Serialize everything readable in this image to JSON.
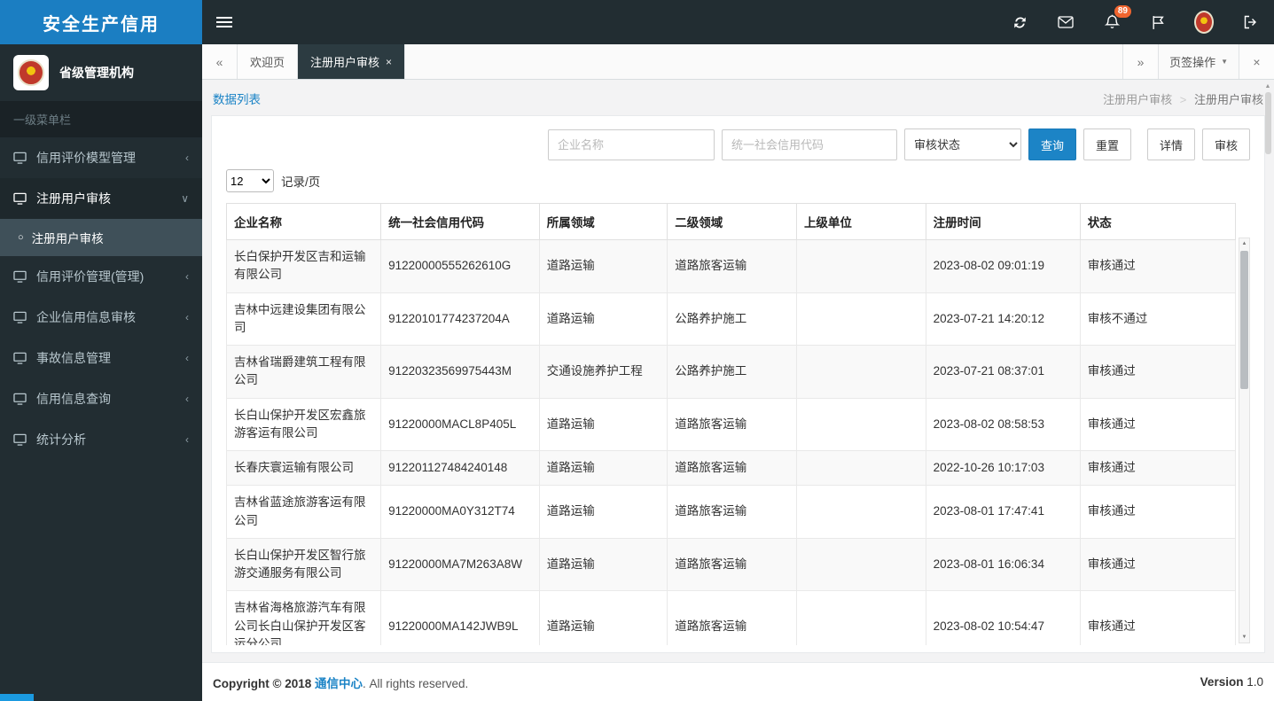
{
  "app": {
    "title": "安全生产信用",
    "org": "省级管理机构",
    "menu_label": "一级菜单栏"
  },
  "topbar": {
    "badge_count": "89"
  },
  "sidebar": {
    "items": [
      {
        "label": "信用评价模型管理",
        "expanded": false
      },
      {
        "label": "注册用户审核",
        "expanded": true,
        "children": [
          {
            "label": "注册用户审核",
            "active": true
          }
        ]
      },
      {
        "label": "信用评价管理(管理)",
        "expanded": false
      },
      {
        "label": "企业信用信息审核",
        "expanded": false
      },
      {
        "label": "事故信息管理",
        "expanded": false
      },
      {
        "label": "信用信息查询",
        "expanded": false
      },
      {
        "label": "统计分析",
        "expanded": false
      }
    ]
  },
  "tabs": {
    "items": [
      {
        "label": "欢迎页",
        "active": false,
        "closable": false
      },
      {
        "label": "注册用户审核",
        "active": true,
        "closable": true
      }
    ],
    "actions_label": "页签操作"
  },
  "breadcrumb": {
    "left": "数据列表",
    "right_parent": "注册用户审核",
    "right_sep": ">",
    "right_current": "注册用户审核"
  },
  "filters": {
    "company_placeholder": "企业名称",
    "code_placeholder": "统一社会信用代码",
    "status_select": "审核状态",
    "search_label": "查询",
    "reset_label": "重置",
    "detail_label": "详情",
    "audit_label": "审核",
    "page_size": "12",
    "page_size_suffix": "记录/页"
  },
  "table": {
    "headers": [
      "企业名称",
      "统一社会信用代码",
      "所属领域",
      "二级领域",
      "上级单位",
      "注册时间",
      "状态"
    ],
    "rows": [
      [
        "长白保护开发区吉和运输有限公司",
        "91220000555262610G",
        "道路运输",
        "道路旅客运输",
        "",
        "2023-08-02 09:01:19",
        "审核通过"
      ],
      [
        "吉林中远建设集团有限公司",
        "91220101774237204A",
        "道路运输",
        "公路养护施工",
        "",
        "2023-07-21 14:20:12",
        "审核不通过"
      ],
      [
        "吉林省瑞爵建筑工程有限公司",
        "91220323569975443M",
        "交通设施养护工程",
        "公路养护施工",
        "",
        "2023-07-21 08:37:01",
        "审核通过"
      ],
      [
        "长白山保护开发区宏鑫旅游客运有限公司",
        "91220000MACL8P405L",
        "道路运输",
        "道路旅客运输",
        "",
        "2023-08-02 08:58:53",
        "审核通过"
      ],
      [
        "长春庆寰运输有限公司",
        "912201127484240148",
        "道路运输",
        "道路旅客运输",
        "",
        "2022-10-26 10:17:03",
        "审核通过"
      ],
      [
        "吉林省蓝途旅游客运有限公司",
        "91220000MA0Y312T74",
        "道路运输",
        "道路旅客运输",
        "",
        "2023-08-01 17:47:41",
        "审核通过"
      ],
      [
        "长白山保护开发区智行旅游交通服务有限公司",
        "91220000MA7M263A8W",
        "道路运输",
        "道路旅客运输",
        "",
        "2023-08-01 16:06:34",
        "审核通过"
      ],
      [
        "吉林省海格旅游汽车有限公司长白山保护开发区客运分公司",
        "91220000MA142JWB9L",
        "道路运输",
        "道路旅客运输",
        "",
        "2023-08-02 10:54:47",
        "审核通过"
      ]
    ]
  },
  "footer": {
    "copyright_prefix": "Copyright © 2018",
    "org_link": "通信中心",
    "copyright_suffix": ". All rights reserved.",
    "version_label": "Version",
    "version_value": "1.0"
  },
  "icons": {
    "scroll_left": "«",
    "scroll_right": "»",
    "close": "×",
    "caret_down": "▼",
    "chevron_left": "‹",
    "chevron_down": "∨",
    "circle": "○",
    "arrow_up": "▲",
    "arrow_down": "▼"
  },
  "colors": {
    "brand_blue": "#1b7ec2",
    "link_blue": "#1c84c6",
    "dark": "#222d32",
    "badge_orange": "#f0652f"
  }
}
